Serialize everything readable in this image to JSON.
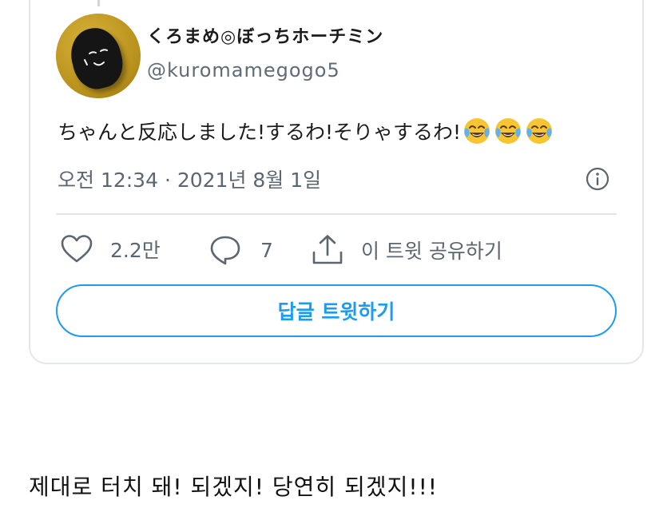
{
  "tweet": {
    "display_name": "くろまめ◎ぼっちホーチミン",
    "handle": "@kuromamegogo5",
    "text": "ちゃんと反応しました!するわ!そりゃするわ!",
    "emojis": [
      "face-with-tears-of-joy",
      "face-with-tears-of-joy",
      "face-with-tears-of-joy"
    ],
    "timestamp": "오전 12:34 · 2021년 8월 1일",
    "likes_count": "2.2만",
    "replies_count": "7",
    "share_label": "이 트윗 공유하기",
    "reply_button_label": "답글 트윗하기"
  },
  "caption": "제대로 터치 돼! 되겠지! 당연히 되겠지!!!",
  "colors": {
    "accent": "#1d9bf0",
    "icon_gray": "#5b6670",
    "border": "#e3e7eb"
  }
}
